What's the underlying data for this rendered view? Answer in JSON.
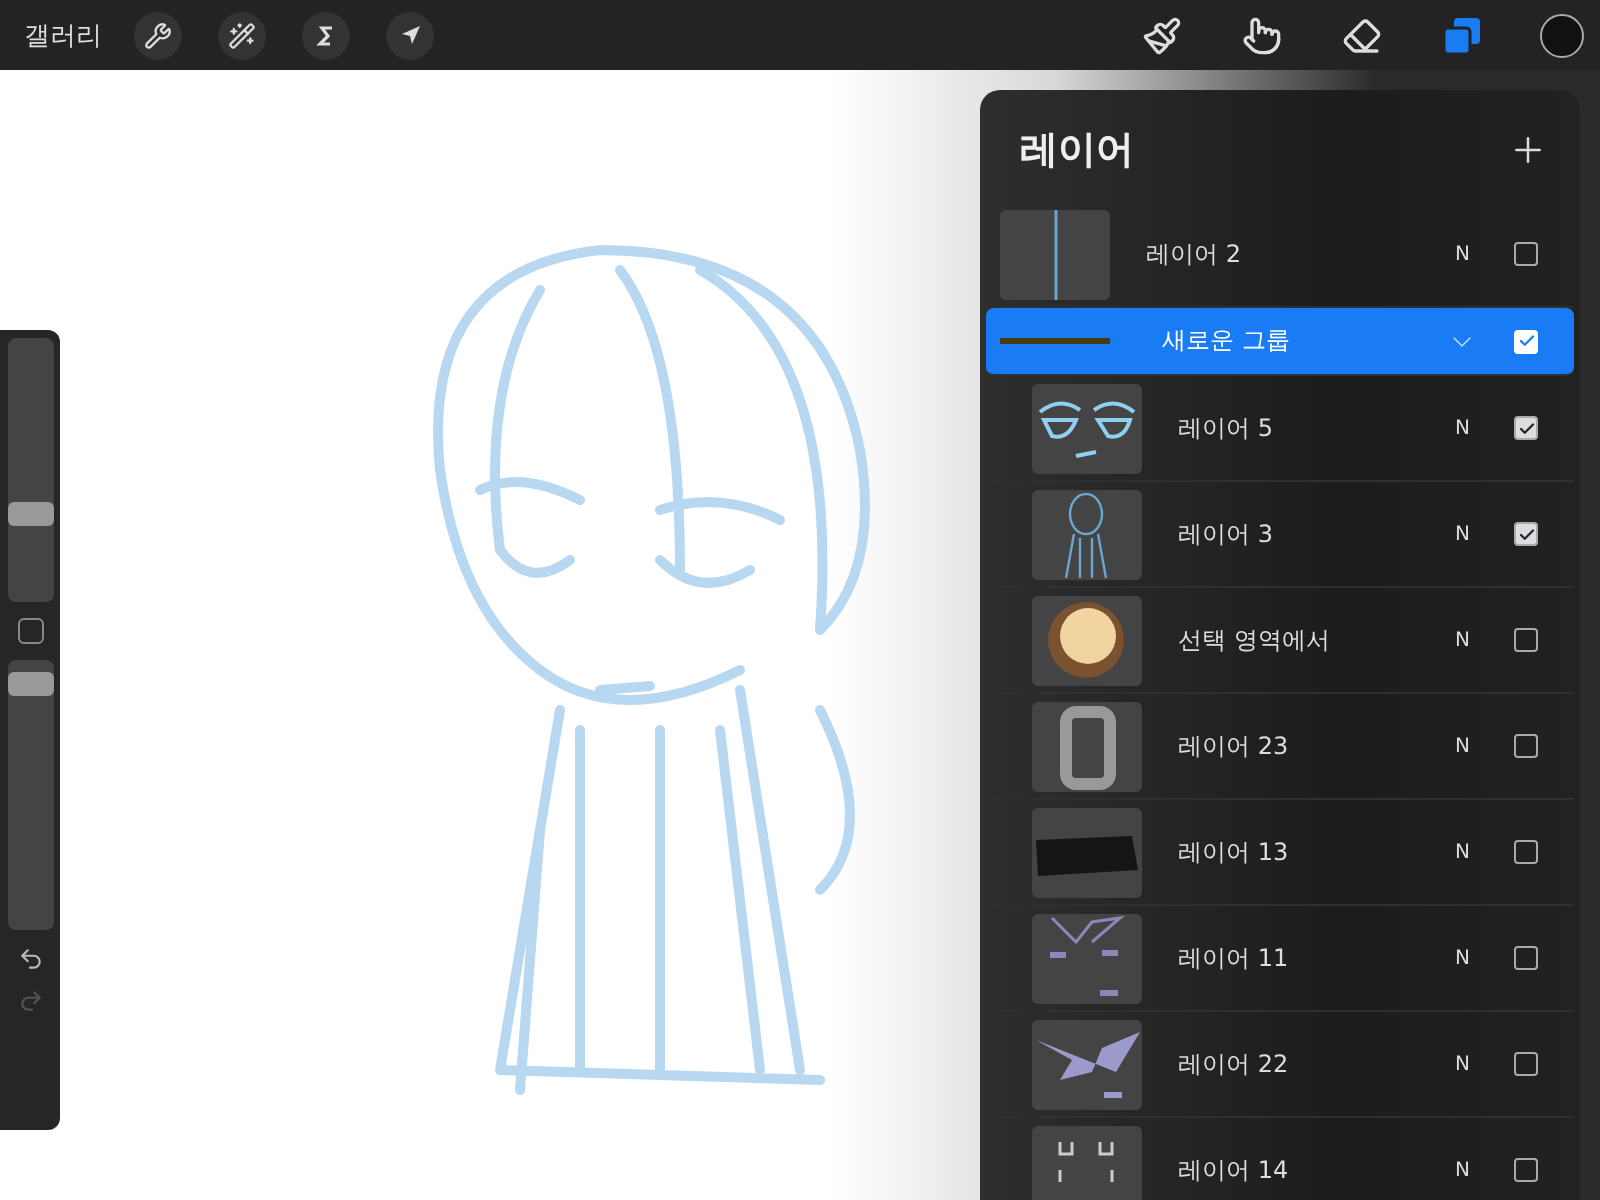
{
  "top_bar": {
    "gallery_label": "갤러리",
    "tools": [
      {
        "kind": "brush",
        "selected": false
      },
      {
        "kind": "smudge",
        "selected": false
      },
      {
        "kind": "eraser",
        "selected": false
      },
      {
        "kind": "layers",
        "selected": true
      }
    ]
  },
  "sidebar": {
    "sliders": [
      {
        "level": 0.32
      },
      {
        "level": 0.95
      }
    ]
  },
  "layers_panel": {
    "title": "레이어",
    "layers": [
      {
        "kind": "layer",
        "name": "레이어 2",
        "blend": "N",
        "checked": false,
        "selected": false
      },
      {
        "kind": "group",
        "name": "새로운 그룹",
        "checked": true,
        "selected": true,
        "expanded": true,
        "children": [
          {
            "name": "레이어 5",
            "blend": "N",
            "checked": true,
            "selected": false
          },
          {
            "name": "레이어 3",
            "blend": "N",
            "checked": true,
            "selected": false
          },
          {
            "name": "선택 영역에서",
            "blend": "N",
            "checked": false,
            "selected": false
          },
          {
            "name": "레이어 23",
            "blend": "N",
            "checked": false,
            "selected": false
          },
          {
            "name": "레이어 13",
            "blend": "N",
            "checked": false,
            "selected": false
          },
          {
            "name": "레이어 11",
            "blend": "N",
            "checked": false,
            "selected": false
          },
          {
            "name": "레이어 22",
            "blend": "N",
            "checked": false,
            "selected": false
          },
          {
            "name": "레이어 14",
            "blend": "N",
            "checked": false,
            "selected": false
          }
        ]
      }
    ]
  }
}
